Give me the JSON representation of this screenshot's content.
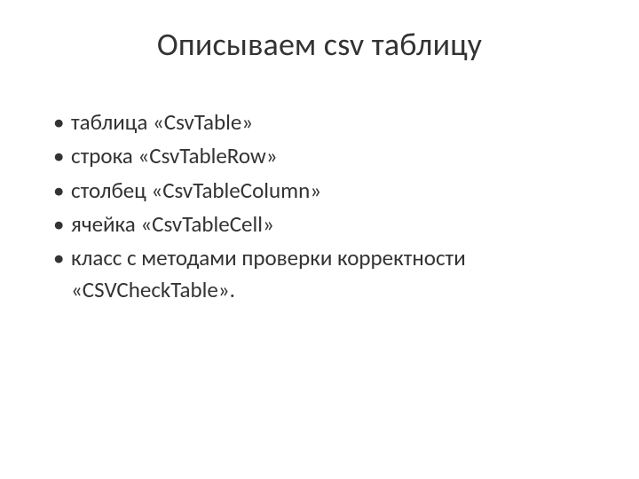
{
  "slide": {
    "title": "Описываем csv таблицу",
    "bullets": [
      "таблица «CsvTable»",
      "строка «CsvTableRow»",
      "столбец «CsvTableColumn»",
      "ячейка «CsvTableCell»",
      "класс с методами проверки корректности «CSVCheckTable»."
    ]
  }
}
